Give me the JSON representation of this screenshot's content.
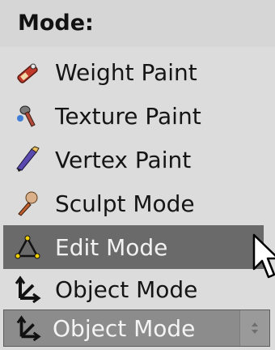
{
  "menu": {
    "title": "Mode:",
    "items": [
      {
        "label": "Weight Paint",
        "icon": "weight-paint-icon"
      },
      {
        "label": "Texture Paint",
        "icon": "texture-paint-icon"
      },
      {
        "label": "Vertex Paint",
        "icon": "vertex-paint-icon"
      },
      {
        "label": "Sculpt Mode",
        "icon": "sculpt-icon"
      },
      {
        "label": "Edit Mode",
        "icon": "edit-mode-icon",
        "highlighted": true
      },
      {
        "label": "Object Mode",
        "icon": "object-mode-icon"
      }
    ],
    "selected": {
      "label": "Object Mode",
      "icon": "object-mode-icon"
    }
  },
  "colors": {
    "menu_bg": "#dcdcdc",
    "highlight_bg": "#6a6a6a",
    "button_bg": "#8c8c8c"
  }
}
